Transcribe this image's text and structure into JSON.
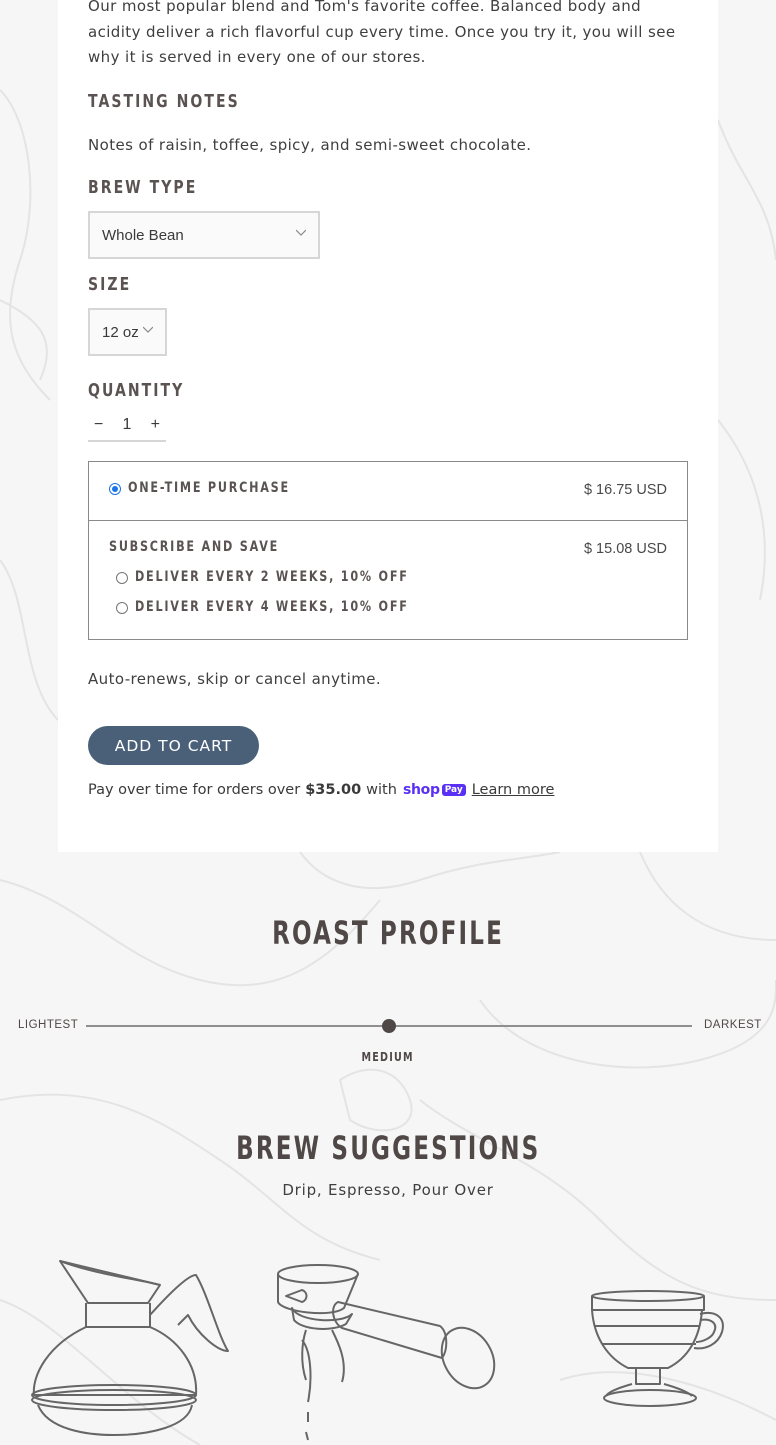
{
  "product": {
    "description": "Our most popular blend and Tom's favorite coffee. Balanced body and acidity deliver a rich flavorful cup every time. Once you try it, you will see why it is served in every one of our stores.",
    "tasting_notes_heading": "TASTING NOTES",
    "tasting_notes": "Notes of raisin, toffee, spicy, and semi-sweet chocolate.",
    "brew_type_heading": "BREW TYPE",
    "brew_type_value": "Whole Bean",
    "size_heading": "SIZE",
    "size_value": "12 oz",
    "quantity_heading": "QUANTITY",
    "quantity": {
      "minus": "−",
      "value": "1",
      "plus": "+"
    }
  },
  "purchase_options": {
    "one_time": {
      "label": "ONE-TIME PURCHASE",
      "price": "$ 16.75 USD",
      "selected": true
    },
    "subscribe": {
      "label": "SUBSCRIBE AND SAVE",
      "price": "$ 15.08 USD",
      "options": [
        {
          "label": "DELIVER EVERY 2 WEEKS, 10% OFF",
          "selected": false
        },
        {
          "label": "DELIVER EVERY 4 WEEKS, 10% OFF",
          "selected": false
        }
      ]
    }
  },
  "auto_renew_note": "Auto-renews, skip or cancel anytime.",
  "add_to_cart_label": "ADD TO CART",
  "shop_pay": {
    "prefix": "Pay over time for orders over",
    "amount": "$35.00",
    "middle": "with",
    "logo_word": "shop",
    "logo_pay": "Pay",
    "learn_more": "Learn more",
    "brand_color": "#5a31f4"
  },
  "roast_profile": {
    "title": "ROAST PROFILE",
    "min_label": "LIGHTEST",
    "max_label": "DARKEST",
    "current_label": "MEDIUM",
    "level": 0.5
  },
  "brew_suggestions": {
    "title": "BREW SUGGESTIONS",
    "methods": "Drip, Espresso, Pour Over",
    "icons": [
      "drip-carafe-icon",
      "espresso-portafilter-icon",
      "pour-over-dripper-icon"
    ]
  },
  "colors": {
    "button": "#4a6079",
    "heading": "#5a5352",
    "background": "#f6f6f6",
    "card": "#ffffff"
  }
}
